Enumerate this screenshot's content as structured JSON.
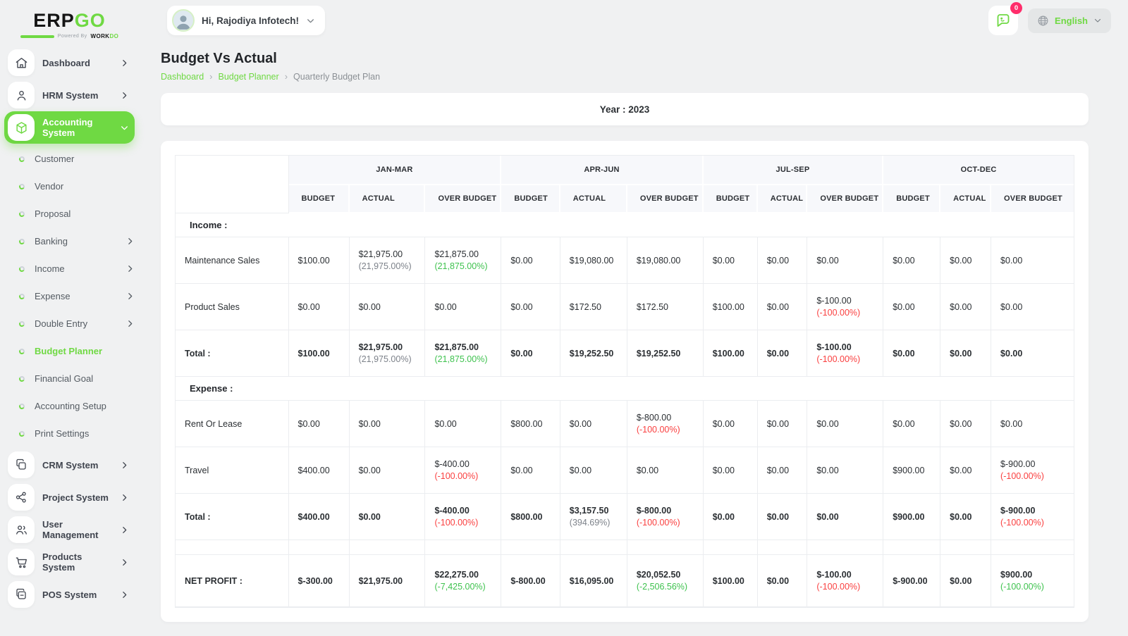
{
  "brand": {
    "name_part1": "ERP",
    "name_part2": "GO",
    "tagline_prefix": "Powered By",
    "tagline_brand": "WORK",
    "tagline_brand_suffix": "DO"
  },
  "colors": {
    "accent_green": "#6fd943",
    "value_green": "#3ec24e",
    "value_red": "#fa4040",
    "muted_gray": "#7d828a",
    "badge_pink": "#ff2d6b"
  },
  "topbar": {
    "greeting": "Hi, Rajodiya Infotech!",
    "badge_count": "0",
    "language": "English"
  },
  "sidebar": {
    "items": [
      {
        "label": "Dashboard"
      },
      {
        "label": "HRM System"
      },
      {
        "label": "Accounting System"
      }
    ],
    "submenu": [
      {
        "label": "Customer"
      },
      {
        "label": "Vendor"
      },
      {
        "label": "Proposal"
      },
      {
        "label": "Banking"
      },
      {
        "label": "Income"
      },
      {
        "label": "Expense"
      },
      {
        "label": "Double Entry"
      },
      {
        "label": "Budget Planner"
      },
      {
        "label": "Financial Goal"
      },
      {
        "label": "Accounting Setup"
      },
      {
        "label": "Print Settings"
      }
    ],
    "items_bottom": [
      {
        "label": "CRM System"
      },
      {
        "label": "Project System"
      },
      {
        "label": "User Management"
      },
      {
        "label": "Products System"
      },
      {
        "label": "POS System"
      }
    ]
  },
  "page": {
    "title": "Budget Vs Actual",
    "year_label": "Year : 2023"
  },
  "breadcrumb": {
    "items": [
      "Dashboard",
      "Budget Planner",
      "Quarterly Budget Plan"
    ]
  },
  "budget_table": {
    "quarters": [
      "JAN-MAR",
      "APR-JUN",
      "JUL-SEP",
      "OCT-DEC"
    ],
    "columns": [
      "BUDGET",
      "ACTUAL",
      "OVER BUDGET"
    ],
    "col_widths": [
      "12.5%",
      "6.7%",
      "8.4%",
      "8.4%",
      "6.5%",
      "7.4%",
      "8.4%",
      "6.0%",
      "5.5%",
      "8.4%",
      "6.3%",
      "5.6%",
      "9.1%"
    ],
    "sections": [
      {
        "title": "Income :",
        "rows": [
          {
            "label": "Maintenance Sales",
            "bold": false,
            "cells": [
              {
                "amount": "$100.00"
              },
              {
                "amount": "$21,975.00",
                "percent": "(21,975.00%)",
                "percent_color": "muted"
              },
              {
                "amount": "$21,875.00",
                "percent": "(21,875.00%)",
                "percent_color": "green"
              },
              {
                "amount": "$0.00"
              },
              {
                "amount": "$19,080.00"
              },
              {
                "amount": "$19,080.00"
              },
              {
                "amount": "$0.00"
              },
              {
                "amount": "$0.00"
              },
              {
                "amount": "$0.00"
              },
              {
                "amount": "$0.00"
              },
              {
                "amount": "$0.00"
              },
              {
                "amount": "$0.00"
              }
            ]
          },
          {
            "label": "Product Sales",
            "bold": false,
            "cells": [
              {
                "amount": "$0.00"
              },
              {
                "amount": "$0.00"
              },
              {
                "amount": "$0.00"
              },
              {
                "amount": "$0.00"
              },
              {
                "amount": "$172.50"
              },
              {
                "amount": "$172.50"
              },
              {
                "amount": "$100.00"
              },
              {
                "amount": "$0.00"
              },
              {
                "amount": "$-100.00",
                "percent": "(-100.00%)",
                "percent_color": "red"
              },
              {
                "amount": "$0.00"
              },
              {
                "amount": "$0.00"
              },
              {
                "amount": "$0.00"
              }
            ]
          },
          {
            "label": "Total :",
            "bold": true,
            "cells": [
              {
                "amount": "$100.00"
              },
              {
                "amount": "$21,975.00",
                "percent": "(21,975.00%)",
                "percent_color": "muted"
              },
              {
                "amount": "$21,875.00",
                "percent": "(21,875.00%)",
                "percent_color": "green"
              },
              {
                "amount": "$0.00"
              },
              {
                "amount": "$19,252.50"
              },
              {
                "amount": "$19,252.50"
              },
              {
                "amount": "$100.00"
              },
              {
                "amount": "$0.00"
              },
              {
                "amount": "$-100.00",
                "percent": "(-100.00%)",
                "percent_color": "red"
              },
              {
                "amount": "$0.00"
              },
              {
                "amount": "$0.00"
              },
              {
                "amount": "$0.00"
              }
            ]
          }
        ]
      },
      {
        "title": "Expense :",
        "rows": [
          {
            "label": "Rent Or Lease",
            "bold": false,
            "cells": [
              {
                "amount": "$0.00"
              },
              {
                "amount": "$0.00"
              },
              {
                "amount": "$0.00"
              },
              {
                "amount": "$800.00"
              },
              {
                "amount": "$0.00"
              },
              {
                "amount": "$-800.00",
                "percent": "(-100.00%)",
                "percent_color": "red"
              },
              {
                "amount": "$0.00"
              },
              {
                "amount": "$0.00"
              },
              {
                "amount": "$0.00"
              },
              {
                "amount": "$0.00"
              },
              {
                "amount": "$0.00"
              },
              {
                "amount": "$0.00"
              }
            ]
          },
          {
            "label": "Travel",
            "bold": false,
            "cells": [
              {
                "amount": "$400.00"
              },
              {
                "amount": "$0.00"
              },
              {
                "amount": "$-400.00",
                "percent": "(-100.00%)",
                "percent_color": "red"
              },
              {
                "amount": "$0.00"
              },
              {
                "amount": "$0.00"
              },
              {
                "amount": "$0.00"
              },
              {
                "amount": "$0.00"
              },
              {
                "amount": "$0.00"
              },
              {
                "amount": "$0.00"
              },
              {
                "amount": "$900.00"
              },
              {
                "amount": "$0.00"
              },
              {
                "amount": "$-900.00",
                "percent": "(-100.00%)",
                "percent_color": "red"
              }
            ]
          },
          {
            "label": "Total :",
            "bold": true,
            "cells": [
              {
                "amount": "$400.00"
              },
              {
                "amount": "$0.00"
              },
              {
                "amount": "$-400.00",
                "percent": "(-100.00%)",
                "percent_color": "red"
              },
              {
                "amount": "$800.00"
              },
              {
                "amount": "$3,157.50",
                "percent": "(394.69%)",
                "percent_color": "muted"
              },
              {
                "amount": "$-800.00",
                "percent": "(-100.00%)",
                "percent_color": "red"
              },
              {
                "amount": "$0.00"
              },
              {
                "amount": "$0.00"
              },
              {
                "amount": "$0.00"
              },
              {
                "amount": "$900.00"
              },
              {
                "amount": "$0.00"
              },
              {
                "amount": "$-900.00",
                "percent": "(-100.00%)",
                "percent_color": "red"
              }
            ]
          }
        ]
      }
    ],
    "net_profit": {
      "label": "NET PROFIT :",
      "cells": [
        {
          "amount": "$-300.00"
        },
        {
          "amount": "$21,975.00"
        },
        {
          "amount": "$22,275.00",
          "percent": "(-7,425.00%)",
          "percent_color": "green"
        },
        {
          "amount": "$-800.00"
        },
        {
          "amount": "$16,095.00"
        },
        {
          "amount": "$20,052.50",
          "percent": "(-2,506.56%)",
          "percent_color": "green"
        },
        {
          "amount": "$100.00"
        },
        {
          "amount": "$0.00"
        },
        {
          "amount": "$-100.00",
          "percent": "(-100.00%)",
          "percent_color": "red"
        },
        {
          "amount": "$-900.00"
        },
        {
          "amount": "$0.00"
        },
        {
          "amount": "$900.00",
          "percent": "(-100.00%)",
          "percent_color": "green"
        }
      ]
    }
  }
}
